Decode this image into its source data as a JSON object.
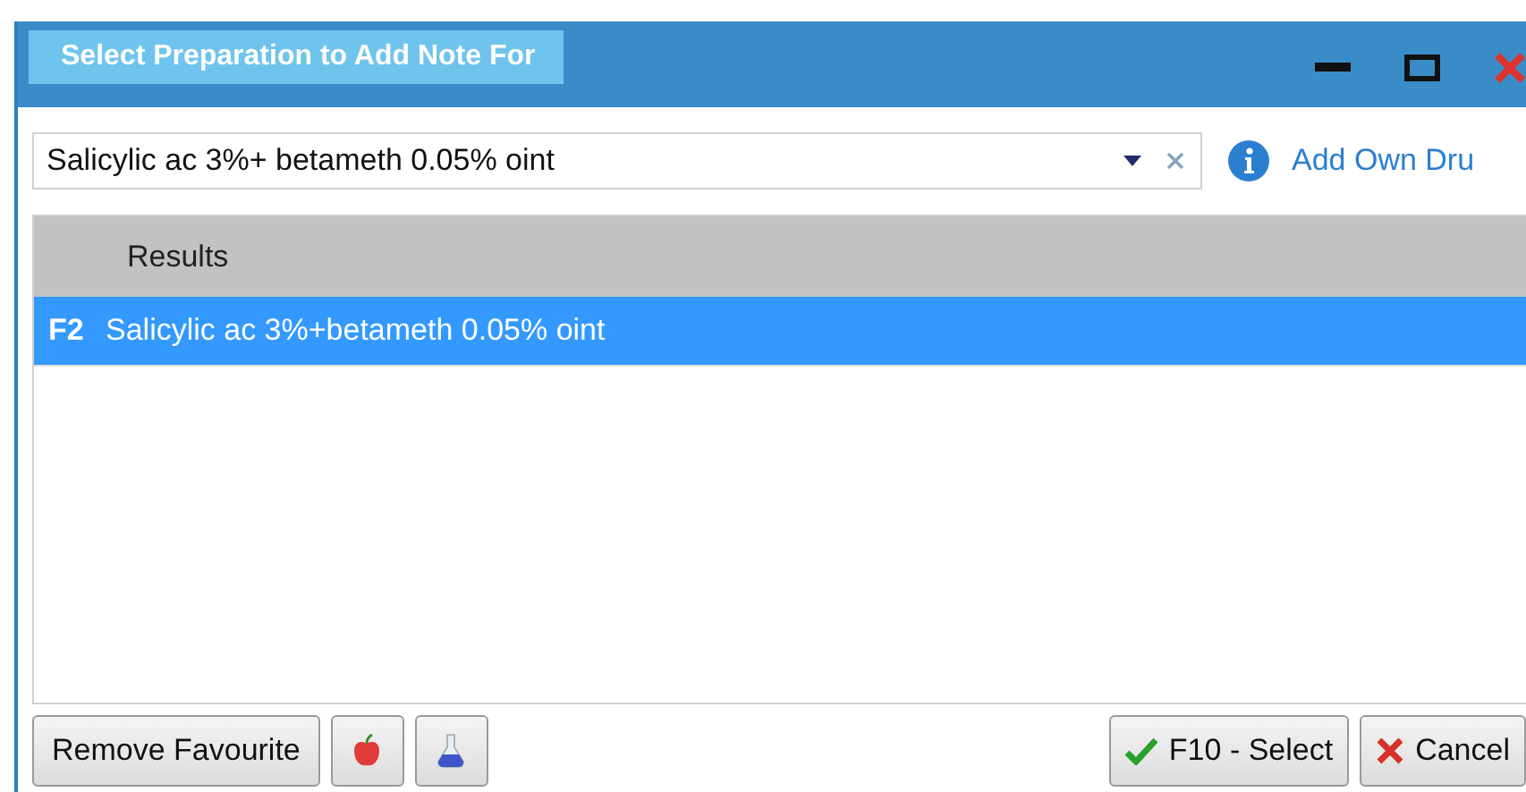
{
  "window": {
    "title": "Select Preparation to Add Note For"
  },
  "search": {
    "value": "Salicylic ac 3%+ betameth 0.05% oint"
  },
  "add_own_drug_link": "Add Own Dru",
  "table": {
    "columns": [
      "Results"
    ],
    "rows": [
      {
        "key": "F2",
        "name": "Salicylic ac 3%+betameth 0.05% oint",
        "selected": true
      }
    ]
  },
  "buttons": [
    {
      "kind": "text",
      "label": "Remove Favourite"
    },
    {
      "kind": "apple"
    },
    {
      "kind": "flask"
    }
  ],
  "actions": [
    {
      "kind": "select",
      "label": "F10 - Select"
    },
    {
      "kind": "cancel",
      "label": "Cancel"
    }
  ]
}
